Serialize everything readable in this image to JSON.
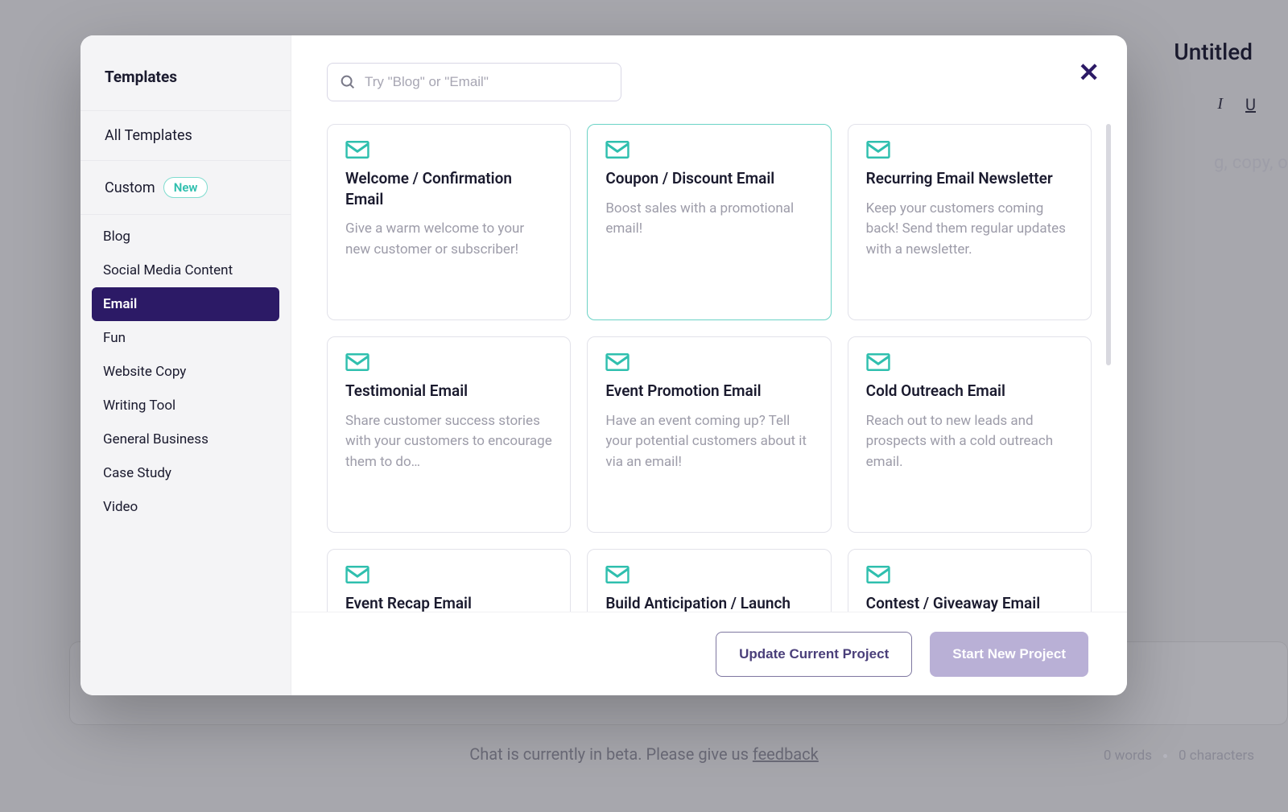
{
  "background": {
    "doc_title": "Untitled",
    "placeholder_tail": "g, copy, o",
    "beta_prefix": "Chat is currently in beta. Please give us ",
    "beta_link": "feedback",
    "words": "0 words",
    "chars": "0 characters"
  },
  "modal": {
    "sidebar": {
      "title": "Templates",
      "all": "All Templates",
      "custom": "Custom",
      "custom_badge": "New",
      "categories": [
        "Blog",
        "Social Media Content",
        "Email",
        "Fun",
        "Website Copy",
        "Writing Tool",
        "General Business",
        "Case Study",
        "Video"
      ],
      "active_index": 2
    },
    "search": {
      "placeholder": "Try \"Blog\" or \"Email\""
    },
    "cards": [
      {
        "title": "Welcome / Confirmation Email",
        "desc": "Give a warm welcome to your new customer or subscriber!",
        "highlight": false
      },
      {
        "title": "Coupon / Discount Email",
        "desc": "Boost sales with a promotional email!",
        "highlight": true
      },
      {
        "title": "Recurring Email Newsletter",
        "desc": "Keep your customers coming back! Send them regular updates with a newsletter.",
        "highlight": false
      },
      {
        "title": "Testimonial Email",
        "desc": "Share customer success stories with your customers to encourage them to do…",
        "highlight": false
      },
      {
        "title": "Event Promotion Email",
        "desc": "Have an event coming up? Tell your potential customers about it via an email!",
        "highlight": false
      },
      {
        "title": "Cold Outreach Email",
        "desc": "Reach out to new leads and prospects with a cold outreach email.",
        "highlight": false
      },
      {
        "title": "Event Recap Email",
        "desc": "",
        "highlight": false
      },
      {
        "title": "Build Anticipation / Launch",
        "desc": "",
        "highlight": false
      },
      {
        "title": "Contest / Giveaway Email",
        "desc": "",
        "highlight": false
      }
    ],
    "footer": {
      "update": "Update Current Project",
      "start": "Start New Project"
    }
  }
}
